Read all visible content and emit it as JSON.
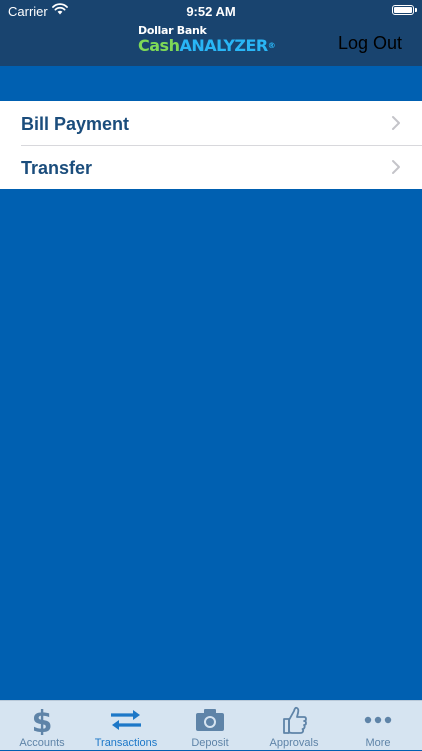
{
  "status_bar": {
    "carrier": "Carrier",
    "time": "9:52 AM",
    "battery_level": 1.0
  },
  "header": {
    "logo_line1": "Dollar Bank",
    "logo_cash": "Cash",
    "logo_analyzer": "ANALYZER",
    "logo_mark": "®",
    "logout_label": "Log Out"
  },
  "menu": {
    "items": [
      {
        "label": "Bill Payment"
      },
      {
        "label": "Transfer"
      }
    ]
  },
  "tabs": [
    {
      "label": "Accounts",
      "icon": "dollar-icon",
      "active": false
    },
    {
      "label": "Transactions",
      "icon": "transfer-arrows-icon",
      "active": true
    },
    {
      "label": "Deposit",
      "icon": "camera-icon",
      "active": false
    },
    {
      "label": "Approvals",
      "icon": "thumbs-up-icon",
      "active": false
    },
    {
      "label": "More",
      "icon": "more-dots-icon",
      "active": false
    }
  ],
  "colors": {
    "nav_bar": "#19446f",
    "background": "#0060b1",
    "menu_text": "#1b4d7c",
    "tab_active": "#1d78c8",
    "tab_inactive": "#5f84a8",
    "logo_cash": "#7ed957",
    "logo_analyzer": "#29b6f6"
  }
}
